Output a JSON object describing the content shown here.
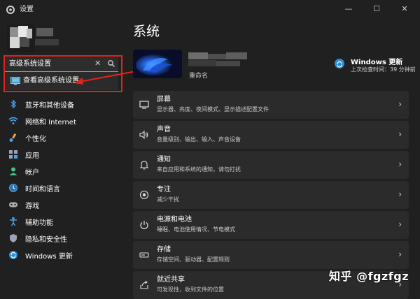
{
  "window": {
    "title": "设置",
    "controls": [
      "—",
      "☐",
      "✕"
    ]
  },
  "search": {
    "value": "高级系统设置",
    "clear_icon": "✕"
  },
  "suggestion": {
    "label": "查看高级系统设置"
  },
  "nav": {
    "items": [
      {
        "label": "蓝牙和其他设备",
        "icon": "bluetooth-icon",
        "color": "#3aa0ff"
      },
      {
        "label": "网络和 Internet",
        "icon": "wifi-icon",
        "color": "#4fb0ff"
      },
      {
        "label": "个性化",
        "icon": "brush-icon",
        "color": "#e8a44a"
      },
      {
        "label": "应用",
        "icon": "apps-icon",
        "color": "#9aa4b8"
      },
      {
        "label": "帐户",
        "icon": "account-icon",
        "color": "#3cc48a"
      },
      {
        "label": "时间和语言",
        "icon": "globe-clock-icon",
        "color": "#4aa3e8"
      },
      {
        "label": "游戏",
        "icon": "gamepad-icon",
        "color": "#b0b0b0"
      },
      {
        "label": "辅助功能",
        "icon": "accessibility-icon",
        "color": "#4aa3e8"
      },
      {
        "label": "隐私和安全性",
        "icon": "shield-icon",
        "color": "#9aa4b8"
      },
      {
        "label": "Windows 更新",
        "icon": "update-icon",
        "color": "#2b8fd8"
      }
    ]
  },
  "main": {
    "title": "系统",
    "device": {
      "rename": "重命名"
    },
    "update": {
      "title": "Windows 更新",
      "subtitle": "上次检查时间：39 分钟前"
    },
    "cards": [
      {
        "title": "屏幕",
        "subtitle": "显示器、亮度、夜间模式、显示描述配置文件",
        "icon": "monitor-icon"
      },
      {
        "title": "声音",
        "subtitle": "音量级别、输出、输入、声音设备",
        "icon": "speaker-icon"
      },
      {
        "title": "通知",
        "subtitle": "来自应用和系统的通知，请勿打扰",
        "icon": "bell-icon"
      },
      {
        "title": "专注",
        "subtitle": "减少干扰",
        "icon": "focus-icon"
      },
      {
        "title": "电源和电池",
        "subtitle": "睡眠、电池使用情况、节电模式",
        "icon": "power-icon"
      },
      {
        "title": "存储",
        "subtitle": "存储空间、驱动器、配置规则",
        "icon": "storage-icon"
      },
      {
        "title": "就近共享",
        "subtitle": "可发现性，收到文件的位置",
        "icon": "share-icon"
      }
    ]
  },
  "watermark": "知乎 @fgzfgz"
}
